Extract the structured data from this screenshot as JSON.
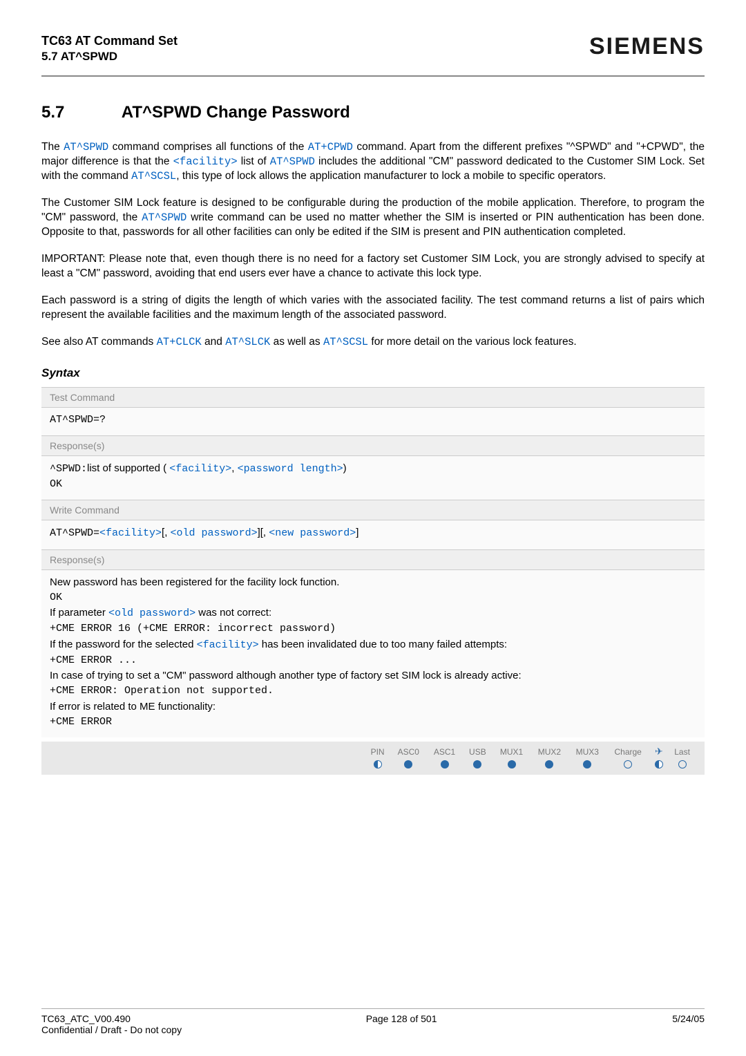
{
  "header": {
    "title": "TC63 AT Command Set",
    "sub": "5.7 AT^SPWD",
    "brand": "SIEMENS"
  },
  "section": {
    "number": "5.7",
    "title": "AT^SPWD   Change Password"
  },
  "paragraphs": {
    "p1a": "The ",
    "p1b": "AT^SPWD",
    "p1c": " command comprises all functions of the ",
    "p1d": "AT+CPWD",
    "p1e": " command. Apart from the different prefixes \"^SPWD\" and \"+CPWD\", the major difference is that the ",
    "p1f": "<facility>",
    "p1g": " list of ",
    "p1h": "AT^SPWD",
    "p1i": " includes the additional \"CM\" password dedicated to the Customer SIM Lock. Set with the command ",
    "p1j": "AT^SCSL",
    "p1k": ", this type of lock allows the application manufacturer to lock a mobile to specific operators.",
    "p2": "The Customer SIM Lock feature is designed to be configurable during the production of the mobile application. Therefore, to program the \"CM\" password, the ",
    "p2b": "AT^SPWD",
    "p2c": " write command can be used no matter whether the SIM is inserted or PIN authentication has been done. Opposite to that, passwords for all other facilities can only be edited if the SIM is present and PIN authentication completed.",
    "p3": "IMPORTANT: Please note that, even though there is no need for a factory set Customer SIM Lock, you are strongly advised to specify at least a \"CM\" password, avoiding that end users ever have a chance to activate this lock type.",
    "p4": "Each password is a string of digits the length of which varies with the associated facility. The test command returns a list of pairs which represent the available facilities and the maximum length of the associated password.",
    "p5a": "See also AT commands ",
    "p5b": "AT+CLCK",
    "p5c": " and ",
    "p5d": "AT^SLCK",
    "p5e": " as well as ",
    "p5f": "AT^SCSL",
    "p5g": " for more detail on the various lock features."
  },
  "syntax": {
    "label": "Syntax",
    "test": {
      "boxlabel": "Test Command",
      "cmd": "AT^SPWD=?",
      "resplabel": "Response(s)",
      "resp_pre": "^SPWD:",
      "resp_mid": "list of supported ( ",
      "resp_fac": "<facility>",
      "resp_comma": ", ",
      "resp_pw": "<password length>",
      "resp_end": ")",
      "ok": "OK"
    },
    "write": {
      "boxlabel": "Write Command",
      "cmd_pre": "AT^SPWD=",
      "cmd_fac": "<facility>",
      "cmd_b1": "[, ",
      "cmd_old": "<old password>",
      "cmd_b2": "][, ",
      "cmd_new": "<new password>",
      "cmd_b3": "]",
      "resplabel": "Response(s)",
      "l1": "New password has been registered for the facility lock function.",
      "ok": "OK",
      "l2a": "If parameter ",
      "l2b": "<old password>",
      "l2c": " was not correct:",
      "l3": "+CME ERROR 16 (+CME ERROR: incorrect password)",
      "l4a": "If the password for the selected ",
      "l4b": "<facility>",
      "l4c": " has been invalidated due to too many failed attempts:",
      "l5": "+CME ERROR ...",
      "l6": "In case of trying to set a \"CM\" password although another type of factory set SIM lock is already active:",
      "l7": "+CME ERROR: Operation not supported.",
      "l8": "If error is related to ME functionality:",
      "l9": "+CME ERROR"
    }
  },
  "support": {
    "cols": [
      "PIN",
      "ASC0",
      "ASC1",
      "USB",
      "MUX1",
      "MUX2",
      "MUX3",
      "Charge",
      "✈",
      "Last"
    ],
    "vals": [
      "half",
      "full",
      "full",
      "full",
      "full",
      "full",
      "full",
      "empty",
      "half",
      "empty"
    ]
  },
  "footer": {
    "left1": "TC63_ATC_V00.490",
    "left2": "Confidential / Draft - Do not copy",
    "center": "Page 128 of 501",
    "right": "5/24/05"
  }
}
